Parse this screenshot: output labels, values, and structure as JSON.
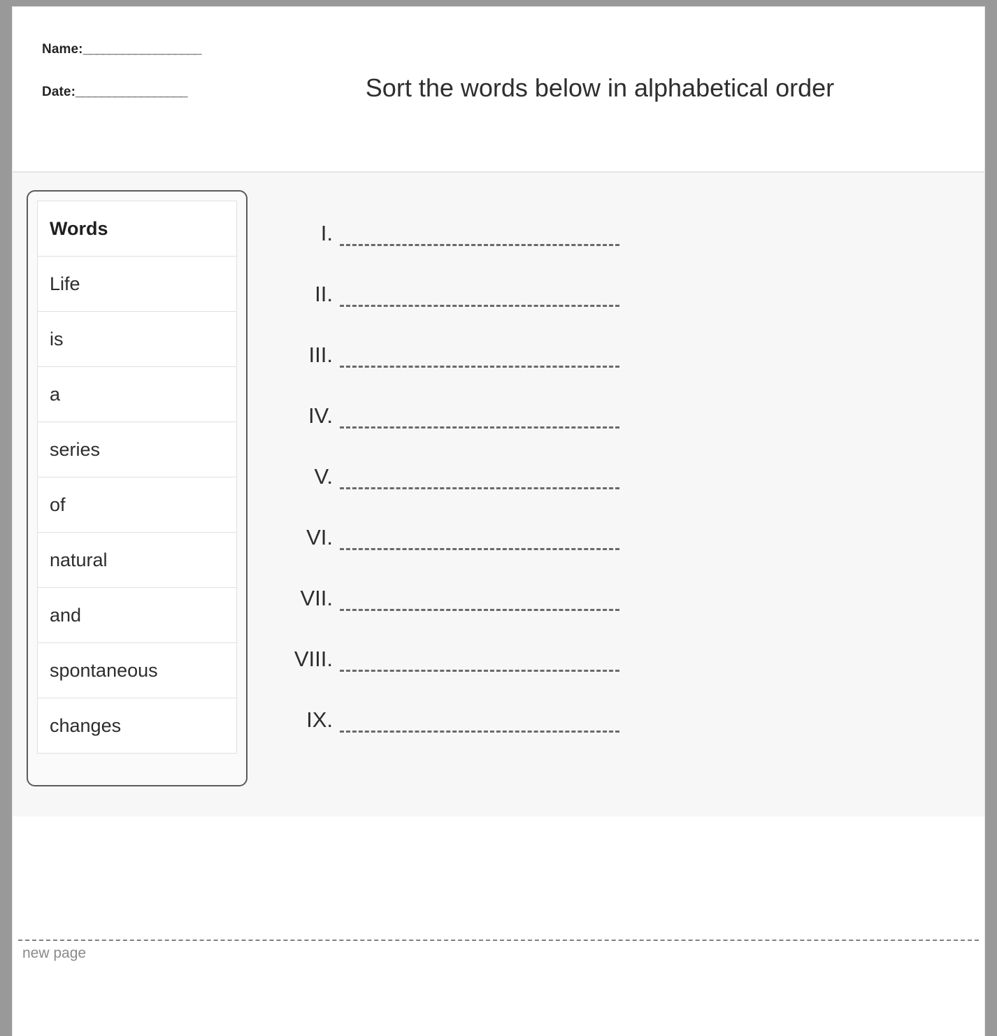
{
  "header": {
    "name_label": "Name:",
    "name_rule": "__________________",
    "date_label": "Date:",
    "date_rule": "_________________",
    "title": "Sort the words below in alphabetical order"
  },
  "words_table": {
    "column_header": "Words",
    "words": [
      "Life",
      "is",
      "a",
      "series",
      "of",
      "natural",
      "and",
      "spontaneous",
      "changes"
    ]
  },
  "answers": {
    "numerals": [
      "I.",
      "II.",
      "III.",
      "IV.",
      "V.",
      "VI.",
      "VII.",
      "VIII.",
      "IX."
    ]
  },
  "footer": {
    "new_page_label": "new page"
  },
  "colors": {
    "page_background": "#ffffff",
    "frame": "#999999",
    "body_background": "#f7f7f7",
    "text": "#2d2d2d",
    "muted_text": "#8a8a8a",
    "panel_border": "#5a5a5a",
    "table_border": "#e0e0e0",
    "dashed_line": "#6a6a6a"
  }
}
